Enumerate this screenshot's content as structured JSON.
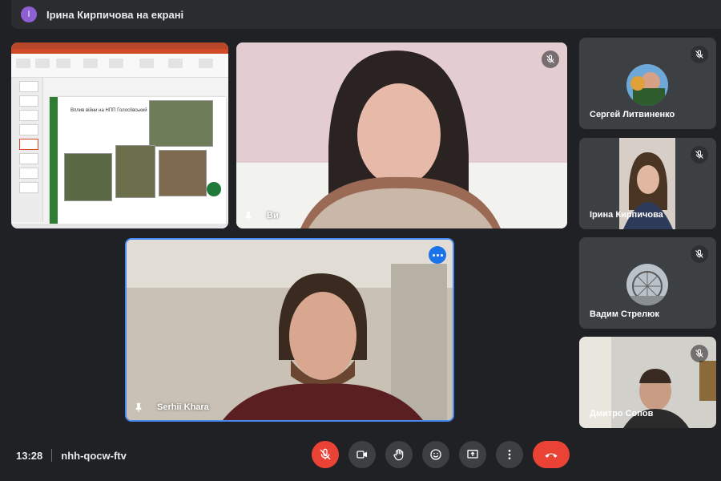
{
  "presentation_banner": {
    "avatar_letter": "І",
    "text": "Ірина Кирпичова на екрані"
  },
  "slide": {
    "heading": "Вплив війни на НПП Голосіївський"
  },
  "tiles": {
    "you": {
      "name": "Ви"
    },
    "main_speaker": {
      "name": "Serhii Khara"
    },
    "side": [
      {
        "name": "Сергей Литвиненко"
      },
      {
        "name": "Ірина Кирпичова"
      },
      {
        "name": "Вадим Стрелюк"
      },
      {
        "name": "Дмитро Сопов"
      }
    ]
  },
  "meeting": {
    "time": "13:28",
    "code": "nhh-qocw-ftv"
  },
  "colors": {
    "background": "#202124",
    "tile": "#3c4043",
    "accent_blue": "#1a73e8",
    "danger_red": "#ea4335"
  },
  "icons": [
    "mic-off-icon",
    "camera-icon",
    "hand-icon",
    "emoji-icon",
    "present-screen-icon",
    "more-vert-icon",
    "end-call-icon",
    "pin-icon",
    "more-horiz-icon"
  ]
}
